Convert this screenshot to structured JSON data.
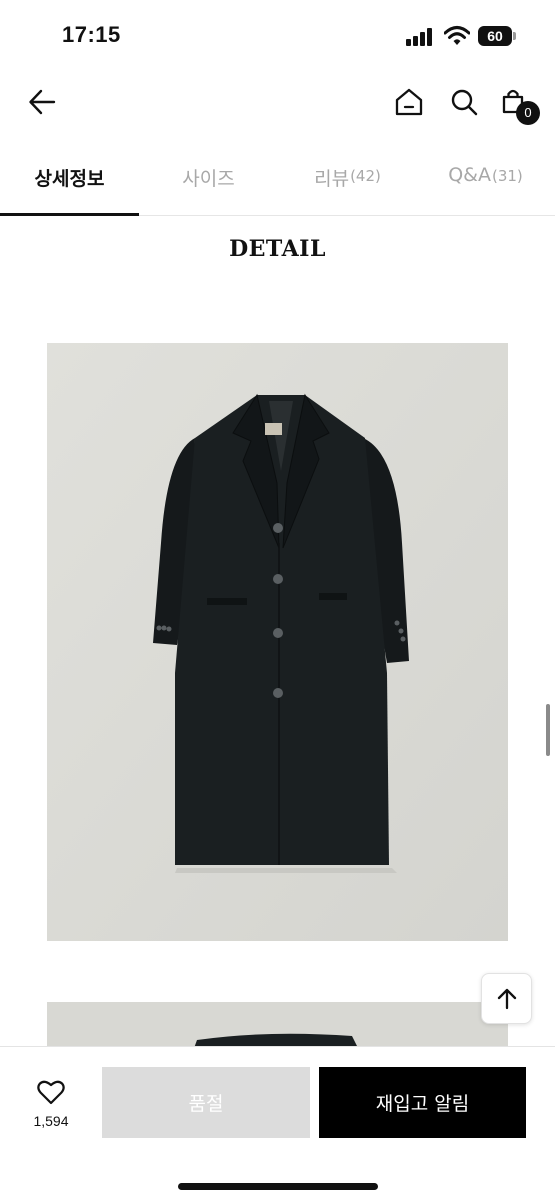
{
  "status_bar": {
    "time": "17:15",
    "battery": "60"
  },
  "nav": {
    "cart_count": "0"
  },
  "tabs": [
    {
      "label": "상세정보",
      "count": ""
    },
    {
      "label": "사이즈",
      "count": ""
    },
    {
      "label": "리뷰",
      "count": "(42)"
    },
    {
      "label": "Q&A",
      "count": "(31)"
    }
  ],
  "content": {
    "section_title": "DETAIL"
  },
  "bottom_bar": {
    "like_count": "1,594",
    "soldout_label": "품절",
    "restock_label": "재입고 알림"
  },
  "icons": {
    "back": "arrow-left-icon",
    "home": "home-icon",
    "search": "search-icon",
    "cart": "shopping-bag-icon",
    "like": "heart-icon",
    "scroll_top": "arrow-up-icon"
  }
}
